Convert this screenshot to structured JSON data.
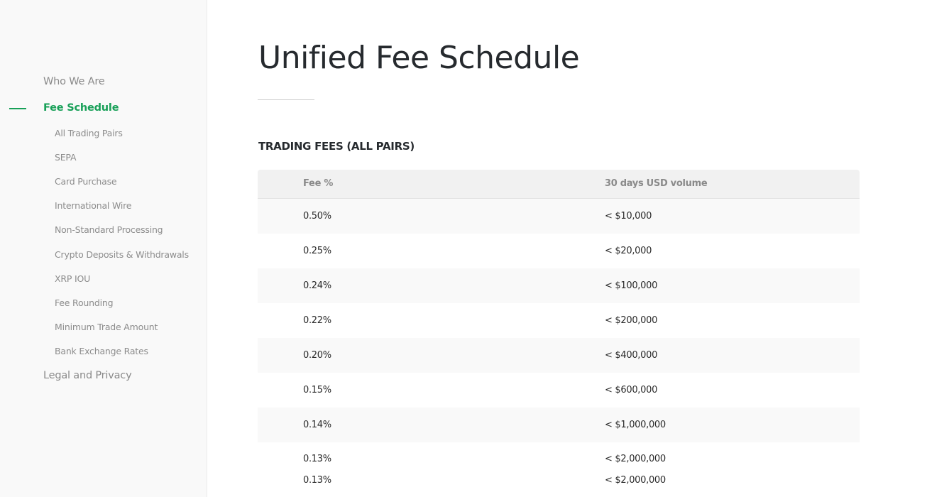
{
  "sidebar": {
    "top_items": [
      {
        "label": "Who We Are"
      },
      {
        "label": "Fee Schedule",
        "active": true
      },
      {
        "label": "Legal and Privacy"
      }
    ],
    "sub_items": [
      {
        "label": "All Trading Pairs"
      },
      {
        "label": "SEPA"
      },
      {
        "label": "Card Purchase"
      },
      {
        "label": "International Wire"
      },
      {
        "label": "Non-Standard Processing"
      },
      {
        "label": "Crypto Deposits & Withdrawals"
      },
      {
        "label": "XRP IOU"
      },
      {
        "label": "Fee Rounding"
      },
      {
        "label": "Minimum Trade Amount"
      },
      {
        "label": "Bank Exchange Rates"
      }
    ],
    "accent_color": "#18a058"
  },
  "main": {
    "title": "Unified Fee Schedule",
    "section_title": "TRADING FEES (ALL PAIRS)",
    "table": {
      "headers": [
        "Fee %",
        "30 days USD volume"
      ],
      "rows": [
        [
          "0.50%",
          "< $10,000"
        ],
        [
          "0.25%",
          "< $20,000"
        ],
        [
          "0.24%",
          "< $100,000"
        ],
        [
          "0.22%",
          "< $200,000"
        ],
        [
          "0.20%",
          "< $400,000"
        ],
        [
          "0.15%",
          "< $600,000"
        ],
        [
          "0.14%",
          "< $1,000,000"
        ],
        [
          "0.13%",
          "< $2,000,000"
        ],
        [
          "0.13%",
          "< $2,000,000"
        ]
      ]
    }
  }
}
